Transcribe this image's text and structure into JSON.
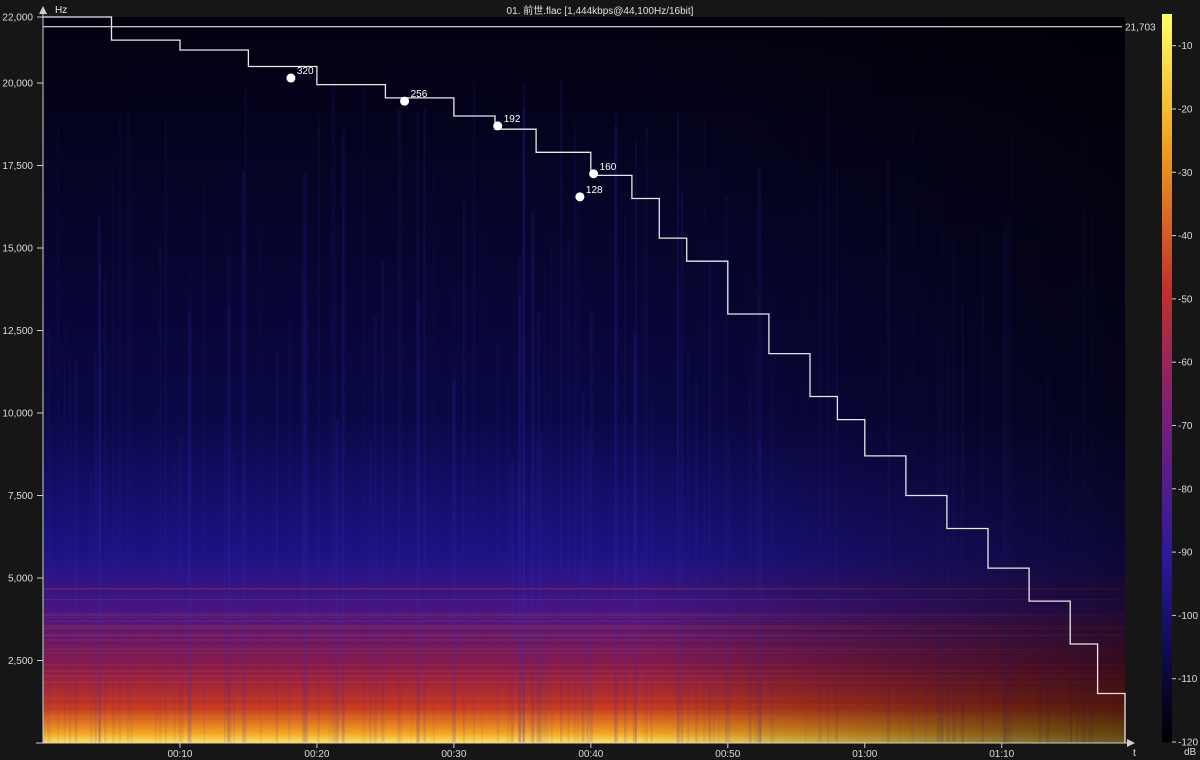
{
  "title": "01. 前世.flac [1,444kbps@44,100Hz/16bit]",
  "colors": {
    "background": "#161616",
    "plot_background": "#000000",
    "axis": "#cfcfcf",
    "cutoff_line": "#ffffff",
    "colorbar_top": "#ffff66",
    "colorbar_mid": "#c0302a",
    "colorbar_low": "#2a1a9a",
    "colorbar_bottom": "#000000"
  },
  "chart_data": {
    "type": "heatmap",
    "title": "01. 前世.flac [1,444kbps@44,100Hz/16bit]",
    "xlabel": "t",
    "ylabel": "Hz",
    "colorbar_label": "dB",
    "x_range_seconds": [
      0,
      79
    ],
    "ylim": [
      0,
      22000
    ],
    "x_ticks": [
      {
        "t": 10,
        "label": "00:10"
      },
      {
        "t": 20,
        "label": "00:20"
      },
      {
        "t": 30,
        "label": "00:30"
      },
      {
        "t": 40,
        "label": "00:40"
      },
      {
        "t": 50,
        "label": "00:50"
      },
      {
        "t": 60,
        "label": "01:00"
      },
      {
        "t": 70,
        "label": "01:10"
      }
    ],
    "y_ticks": [
      {
        "v": 2500,
        "label": "2,500"
      },
      {
        "v": 5000,
        "label": "5,000"
      },
      {
        "v": 7500,
        "label": "7,500"
      },
      {
        "v": 10000,
        "label": "10,000"
      },
      {
        "v": 12500,
        "label": "12,500"
      },
      {
        "v": 15000,
        "label": "15,000"
      },
      {
        "v": 17500,
        "label": "17,500"
      },
      {
        "v": 20000,
        "label": "20,000"
      },
      {
        "v": 22000,
        "label": "22,000"
      }
    ],
    "cutoff_frequency": {
      "value": 21703,
      "label": "21,703"
    },
    "colorbar_range_db": [
      -120,
      -5
    ],
    "colorbar_ticks": [
      {
        "v": -10,
        "label": "-10"
      },
      {
        "v": -20,
        "label": "-20"
      },
      {
        "v": -30,
        "label": "-30"
      },
      {
        "v": -40,
        "label": "-40"
      },
      {
        "v": -50,
        "label": "-50"
      },
      {
        "v": -60,
        "label": "-60"
      },
      {
        "v": -70,
        "label": "-70"
      },
      {
        "v": -80,
        "label": "-80"
      },
      {
        "v": -90,
        "label": "-90"
      },
      {
        "v": -100,
        "label": "-100"
      },
      {
        "v": -110,
        "label": "-110"
      },
      {
        "v": -120,
        "label": "-120"
      }
    ],
    "bitrate_markers": [
      {
        "t": 18.1,
        "hz": 20150,
        "label": "320"
      },
      {
        "t": 26.4,
        "hz": 19450,
        "label": "256"
      },
      {
        "t": 33.2,
        "hz": 18700,
        "label": "192"
      },
      {
        "t": 40.2,
        "hz": 17250,
        "label": "160"
      },
      {
        "t": 39.2,
        "hz": 16550,
        "label": "128"
      }
    ],
    "highest_frequency_curve": [
      {
        "t": 0,
        "hz": 22000
      },
      {
        "t": 5,
        "hz": 21300
      },
      {
        "t": 10,
        "hz": 21000
      },
      {
        "t": 15,
        "hz": 20500
      },
      {
        "t": 20,
        "hz": 19950
      },
      {
        "t": 25,
        "hz": 19550
      },
      {
        "t": 30,
        "hz": 19000
      },
      {
        "t": 33,
        "hz": 18600
      },
      {
        "t": 36,
        "hz": 17900
      },
      {
        "t": 40,
        "hz": 17200
      },
      {
        "t": 43,
        "hz": 16500
      },
      {
        "t": 45,
        "hz": 15300
      },
      {
        "t": 47,
        "hz": 14600
      },
      {
        "t": 50,
        "hz": 13000
      },
      {
        "t": 53,
        "hz": 11800
      },
      {
        "t": 56,
        "hz": 10500
      },
      {
        "t": 58,
        "hz": 9800
      },
      {
        "t": 60,
        "hz": 8700
      },
      {
        "t": 63,
        "hz": 7500
      },
      {
        "t": 66,
        "hz": 6500
      },
      {
        "t": 69,
        "hz": 5300
      },
      {
        "t": 72,
        "hz": 4300
      },
      {
        "t": 75,
        "hz": 3000
      },
      {
        "t": 77,
        "hz": 1500
      },
      {
        "t": 79,
        "hz": 0
      }
    ],
    "grid": false,
    "legend": "colorbar right"
  }
}
